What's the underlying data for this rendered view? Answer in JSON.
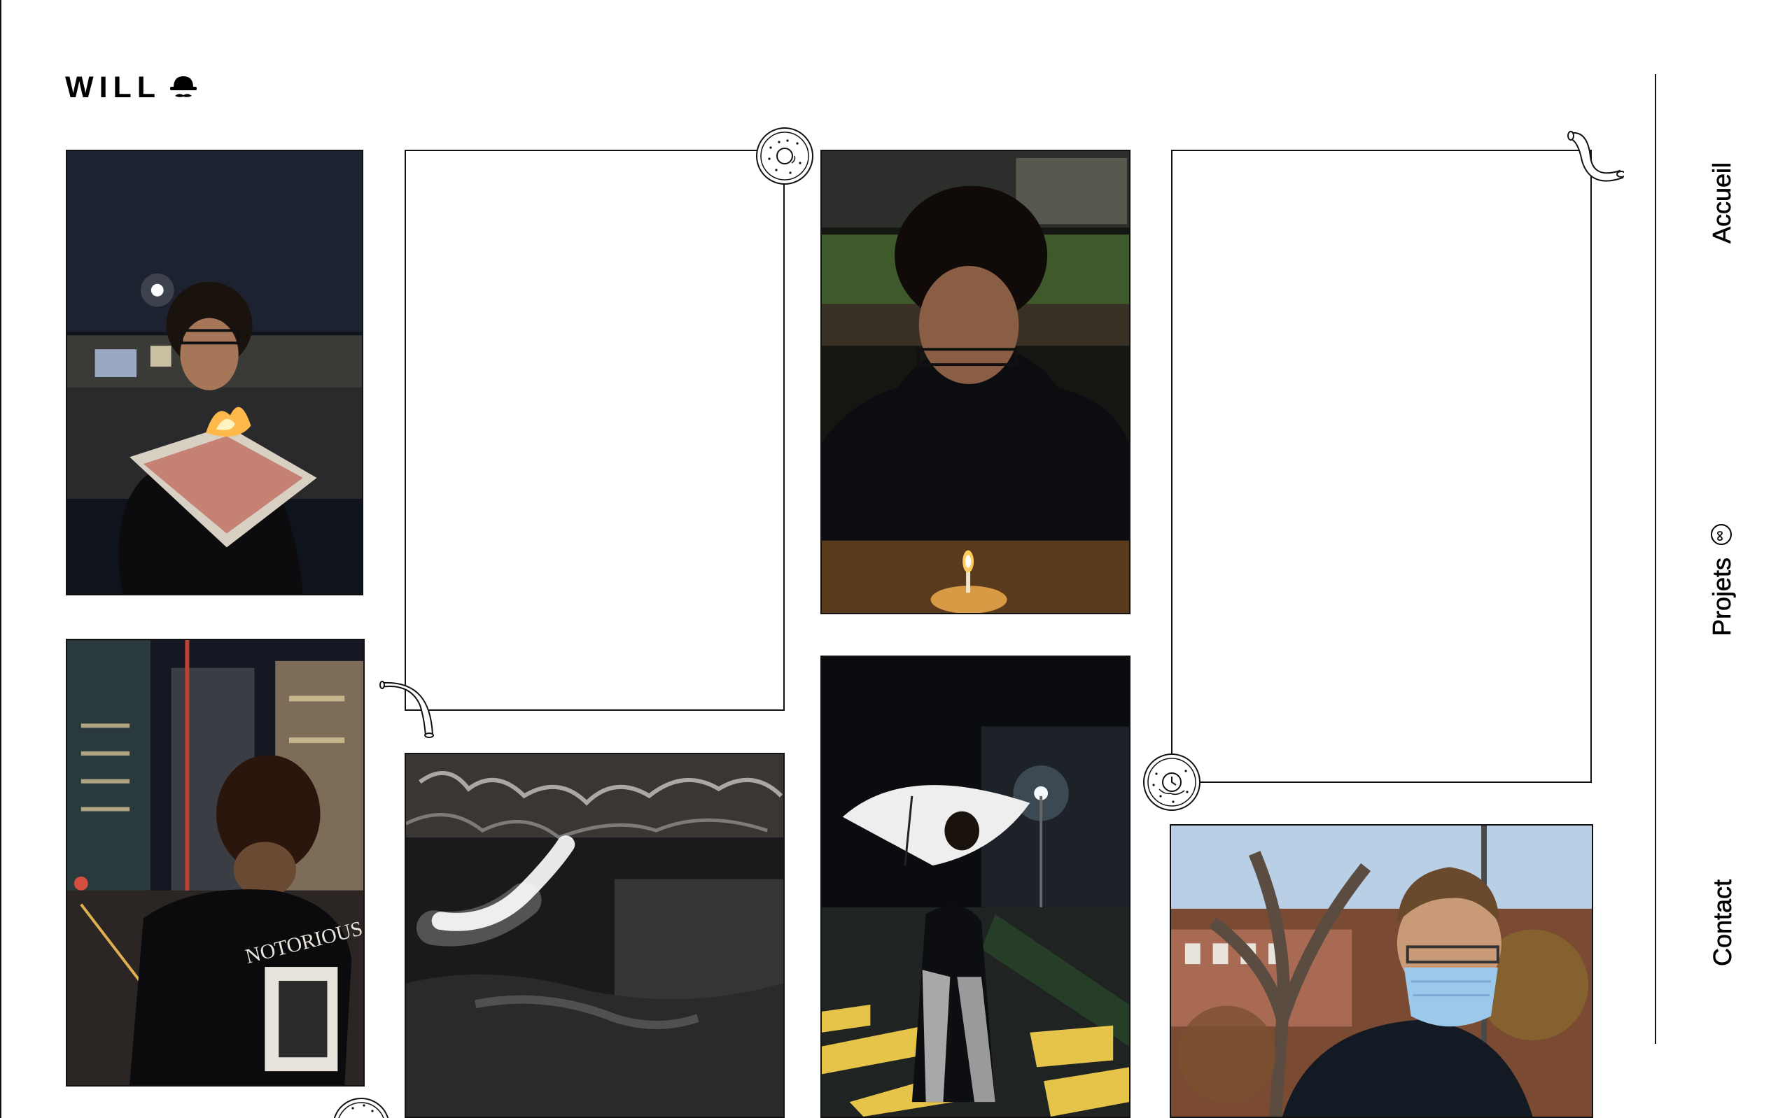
{
  "brand": {
    "logo_text": "WILL",
    "logo_icon": "bowler-hat-mustache-icon"
  },
  "nav": {
    "items": [
      {
        "label": "Accueil"
      },
      {
        "label": "Projets",
        "badge_icon": "infinity-badge-icon"
      },
      {
        "label": "Contact"
      }
    ]
  },
  "gallery": {
    "photos": [
      {
        "icon": "photo-newspaper-burning"
      },
      {
        "icon": "photo-back-view-city-night"
      },
      {
        "icon": "photo-light-painting-abstract"
      },
      {
        "icon": "photo-candle-birthday"
      },
      {
        "icon": "photo-umbrella-crosswalk"
      },
      {
        "icon": "photo-face-mask-trees"
      }
    ],
    "decorations": [
      "donut-icon",
      "macaroni-icon",
      "clock-donut-icon"
    ]
  },
  "colors": {
    "background": "#ffffff",
    "stroke": "#111111"
  }
}
